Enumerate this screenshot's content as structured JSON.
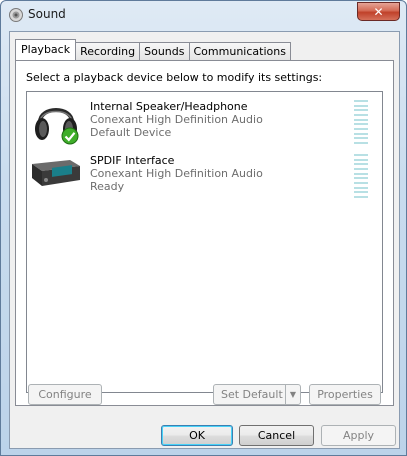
{
  "window": {
    "title": "Sound",
    "close_label": "✕"
  },
  "tabs": [
    {
      "label": "Playback",
      "active": true
    },
    {
      "label": "Recording",
      "active": false
    },
    {
      "label": "Sounds",
      "active": false
    },
    {
      "label": "Communications",
      "active": false
    }
  ],
  "playback": {
    "instructions": "Select a playback device below to modify its settings:",
    "devices": [
      {
        "name": "Internal Speaker/Headphone",
        "driver": "Conexant High Definition Audio",
        "status": "Default Device",
        "icon": "headphones-icon",
        "is_default": true
      },
      {
        "name": "SPDIF Interface",
        "driver": "Conexant High Definition Audio",
        "status": "Ready",
        "icon": "spdif-device-icon",
        "is_default": false
      }
    ],
    "configure_label": "Configure",
    "set_default_label": "Set Default",
    "properties_label": "Properties"
  },
  "dialog_buttons": {
    "ok_label": "OK",
    "cancel_label": "Cancel",
    "apply_label": "Apply"
  },
  "colors": {
    "level_meter": "#b8e0e4",
    "default_check": "#3fae2a"
  }
}
